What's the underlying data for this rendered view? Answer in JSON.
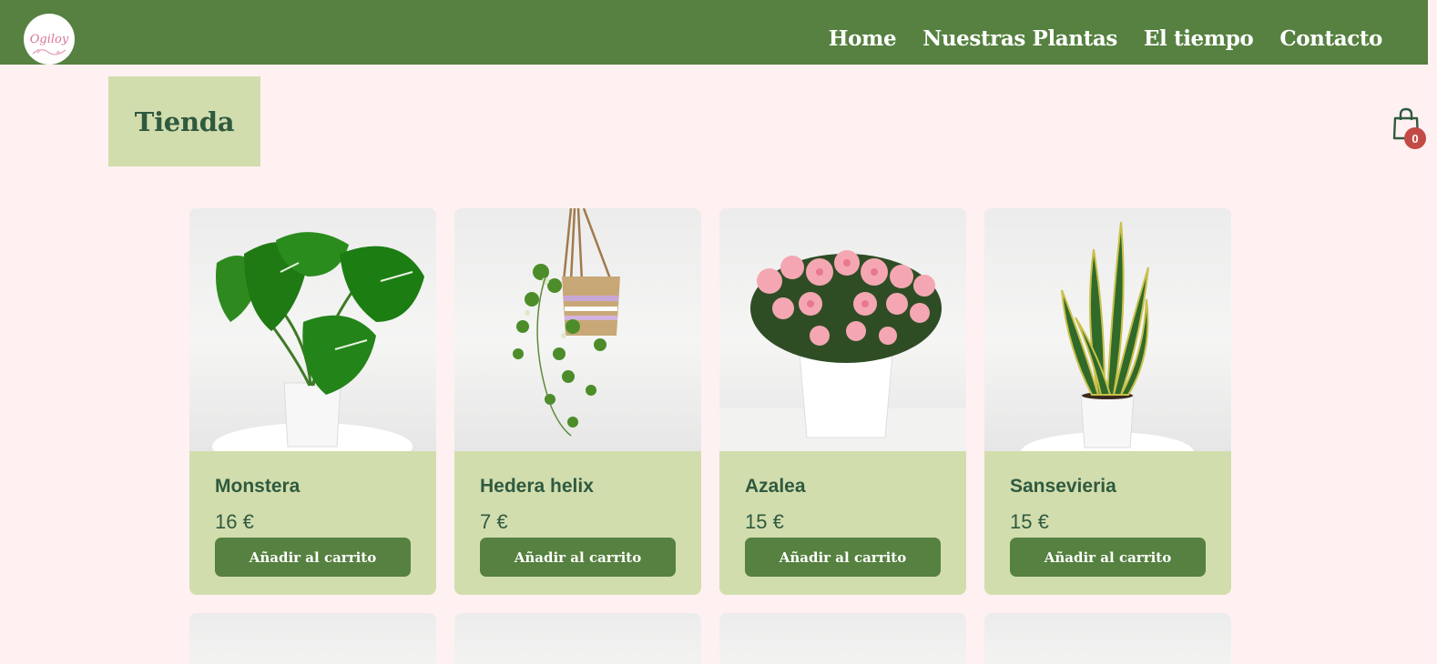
{
  "brand": {
    "logo_text": "Ogiloy",
    "logo_icon": "floral-logo-icon"
  },
  "nav": {
    "items": [
      {
        "label": "Home"
      },
      {
        "label": "Nuestras Plantas"
      },
      {
        "label": "El tiempo"
      },
      {
        "label": "Contacto"
      }
    ]
  },
  "page": {
    "title": "Tienda"
  },
  "cart": {
    "icon": "shopping-bag-icon",
    "count": "0"
  },
  "products": [
    {
      "name": "Monstera",
      "price": "16 €",
      "button": "Añadir al carrito",
      "image_icon": "monstera-plant-image"
    },
    {
      "name": "Hedera helix",
      "price": "7 €",
      "button": "Añadir al carrito",
      "image_icon": "hanging-ivy-image"
    },
    {
      "name": "Azalea",
      "price": "15 €",
      "button": "Añadir al carrito",
      "image_icon": "azalea-flower-image"
    },
    {
      "name": "Sansevieria",
      "price": "15 €",
      "button": "Añadir al carrito",
      "image_icon": "snake-plant-image"
    }
  ],
  "colors": {
    "primary_green": "#568140",
    "card_green": "#d2ddae",
    "text_green": "#2f5a3f",
    "page_bg": "#fff1f1",
    "badge_red": "#c24b46"
  }
}
